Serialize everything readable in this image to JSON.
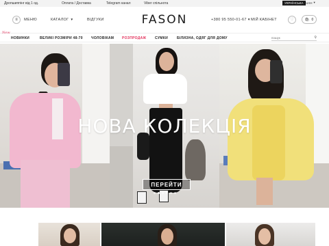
{
  "topbar": {
    "dropshipping": "Дропшиппінг від 1 од.",
    "payment": "Оплата / Доставка",
    "telegram": "Telegram канал",
    "viber": "Viber спільнота",
    "language": "УКРАЇНСЬКА",
    "currency": "UAH"
  },
  "header": {
    "menu_label": "МЕНЮ",
    "catalog_label": "КАТАЛОГ",
    "reviews_label": "ВІДГУКИ",
    "logo": "FASON",
    "phone": "+380 95 550-01-67",
    "cabinet_label": "МІЙ КАБІНЕТ",
    "cart_count": "0"
  },
  "nav": {
    "badge": "New",
    "items": [
      "НОВИНКИ",
      "ВЕЛИКІ РОЗМІРИ 48-70",
      "ЧОЛОВІКАМ",
      "РОЗПРОДАЖ",
      "СУМКИ",
      "БІЛИЗНА, ОДЯГ ДЛЯ ДОМУ"
    ],
    "search_placeholder": "пошук"
  },
  "hero": {
    "title": "НОВА КОЛЕКЦІЯ",
    "button": "ПЕРЕЙТИ",
    "slides": 6,
    "active_slide": 1
  },
  "colors": {
    "sale": "#e2325c",
    "dark": "#1c1c1c",
    "outfit_pink": "#f2b8cf",
    "outfit_white": "#ffffff",
    "outfit_yellow": "#f1e07a"
  },
  "icons": [
    "menu-icon",
    "chevron-down-icon",
    "phone-icon",
    "heart-icon",
    "cart-icon",
    "search-icon"
  ]
}
